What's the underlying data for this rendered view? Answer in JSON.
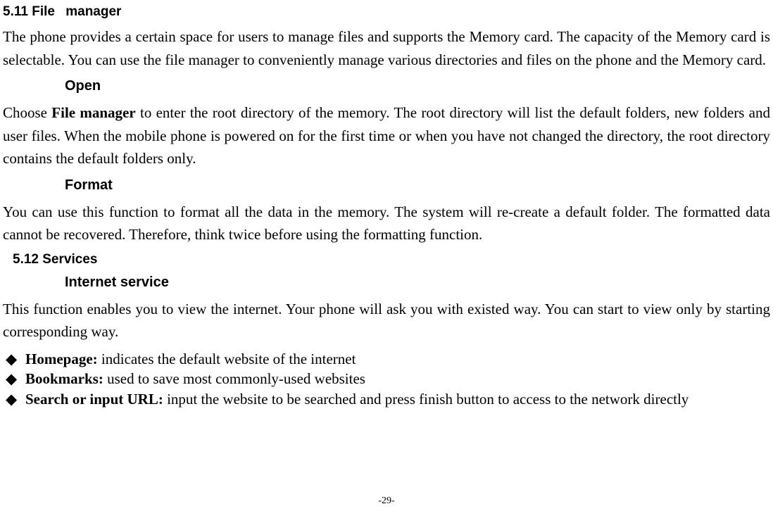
{
  "sections": {
    "file_manager": {
      "number_label": "5.11 File",
      "number_rest": "manager",
      "intro": "The phone provides a certain space for users to manage files and supports the Memory card. The capacity of the Memory card is selectable. You can use the file manager to conveniently manage various directories and files on the phone and the Memory card.",
      "open": {
        "heading": "Open",
        "body_prefix": "Choose ",
        "body_bold": "File manager",
        "body_suffix": " to enter the root directory of the memory. The root directory will list the default folders, new folders and user files. When the mobile phone is powered on for the first time or when you have not changed the directory, the root directory contains the default folders only."
      },
      "format": {
        "heading": "Format",
        "body": "You can use this function to format all the data in the memory. The system will re-create a default folder. The formatted data cannot be recovered. Therefore, think twice before using the formatting function."
      }
    },
    "services": {
      "number_label": "5.12 Services",
      "internet": {
        "heading": "Internet service",
        "body": "This function enables you to view the internet. Your phone will ask you with existed way. You can start to view only by starting corresponding way.",
        "bullets": [
          {
            "term": "Homepage:",
            "desc": " indicates the default website of the internet"
          },
          {
            "term": "Bookmarks:",
            "desc": " used to save most commonly-used websites"
          },
          {
            "term": "Search or input URL:",
            "desc": " input the website to be searched and press finish button to access to the network directly"
          }
        ]
      }
    }
  },
  "page_number": "-29-"
}
